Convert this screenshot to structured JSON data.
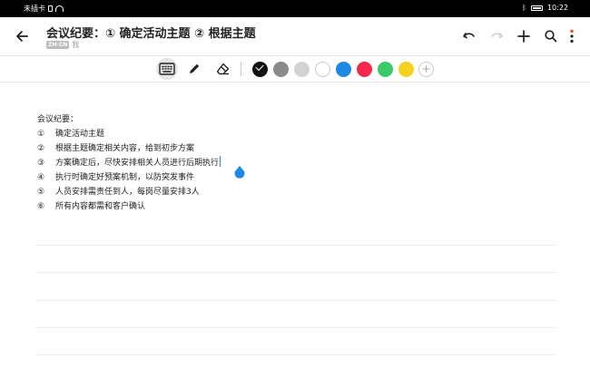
{
  "status_bar": {
    "carrier": "未插卡",
    "time": "10:22"
  },
  "header": {
    "title": "会议纪要：① 确定活动主题 ② 根据主题",
    "lang_badge": "ZH-CN",
    "author": "我"
  },
  "toolbar": {
    "tools": [
      "keyboard-tool",
      "pen-tool",
      "eraser-tool"
    ],
    "colors": [
      "#111111",
      "#8a8a8a",
      "#d2d2d2",
      "#ffffff",
      "#1e88e5",
      "#f3284a",
      "#3bc96a",
      "#f5d21f"
    ],
    "selected_color": "#111111",
    "accent": "#1e88e5"
  },
  "note": {
    "heading": "会议纪要：",
    "items": [
      {
        "num": "①",
        "text": "确定活动主题"
      },
      {
        "num": "②",
        "text": "根据主题确定相关内容，给到初步方案"
      },
      {
        "num": "③",
        "text": "方案确定后，尽快安排相关人员进行后期执行"
      },
      {
        "num": "④",
        "text": "执行时确定好预案机制，以防突发事件"
      },
      {
        "num": "⑤",
        "text": "人员安排需责任到人，每岗尽量安排3人"
      },
      {
        "num": "⑥",
        "text": "所有内容都需和客户确认"
      }
    ]
  }
}
